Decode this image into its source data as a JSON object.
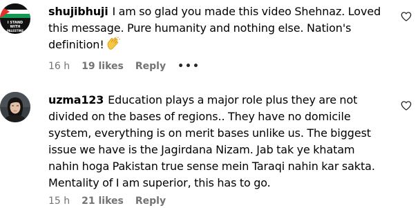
{
  "comments": [
    {
      "username": "shujibhuji",
      "text": "I am so glad you made this video Shehnaz. Loved this message. Pure humanity and nothing else. Nation's definition!",
      "emoji": "clapping-hands",
      "time": "16 h",
      "likes": "19 likes",
      "reply": "Reply",
      "more": "•••",
      "avatar_text": [
        "I STAND",
        "WITH",
        "PALESTINE"
      ]
    },
    {
      "username": "uzma123",
      "text": "Education plays a major role plus they are not divided on the bases of regions.. They have no domicile system, everything is on merit bases unlike us. The biggest issue we have is the Jagirdana Nizam. Jab tak ye khatam nahin hoga Pakistan true sense mein Taraqi nahin kar sakta. Mentality of I am superior, this has to go.",
      "time": "15 h",
      "likes": "21 likes",
      "reply": "Reply"
    }
  ],
  "colors": {
    "meta": "#737373",
    "flag_red": "#e4312b",
    "flag_green": "#149954"
  }
}
